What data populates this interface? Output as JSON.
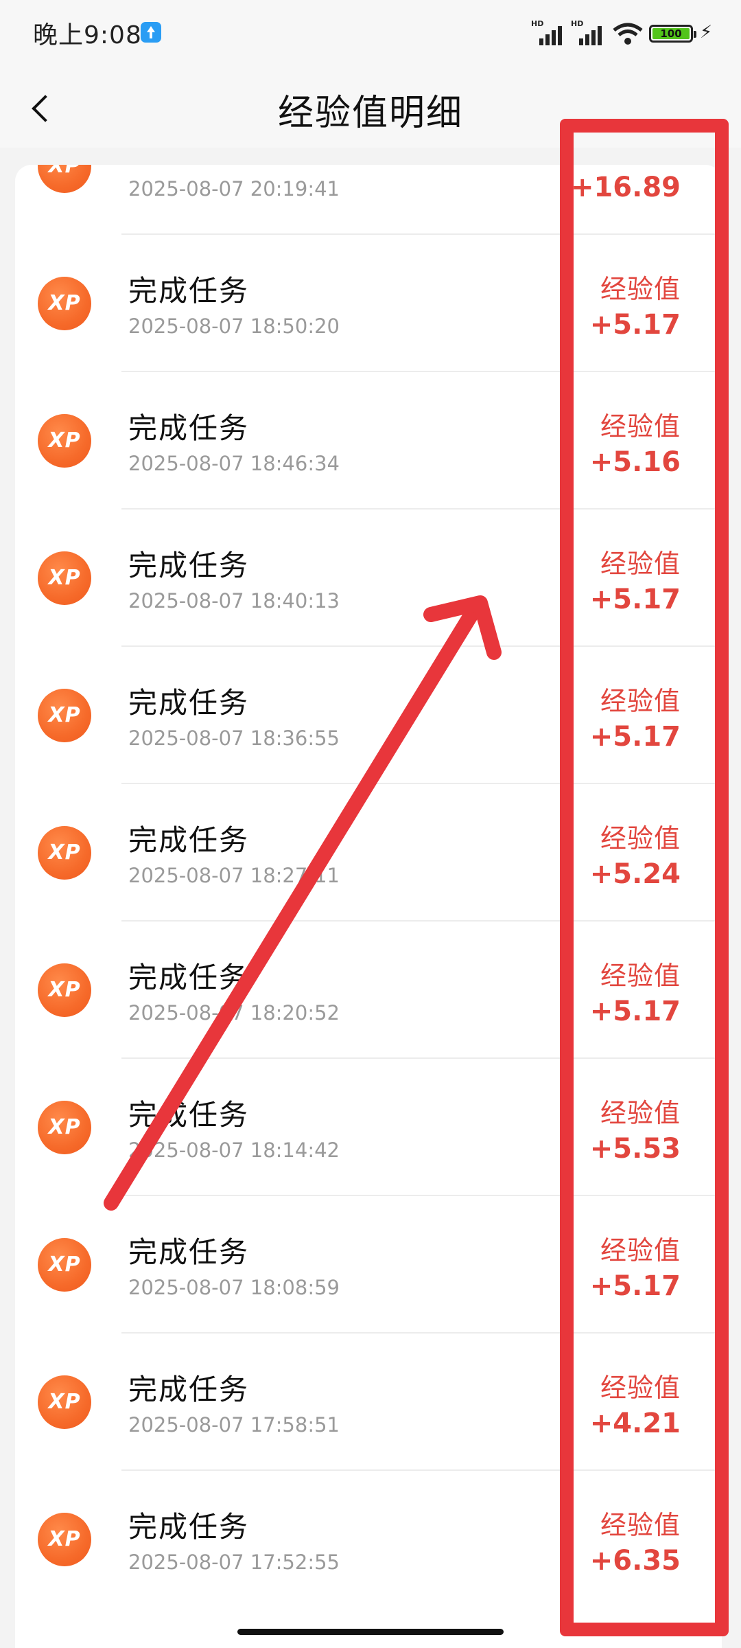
{
  "status_bar": {
    "time": "晚上9:08",
    "signal1": "HD",
    "signal2": "HD",
    "battery": "100",
    "icons": [
      "upload-notification-icon",
      "signal-icon",
      "signal-icon",
      "wifi-icon",
      "battery-icon",
      "charging-icon"
    ]
  },
  "header": {
    "title": "经验值明细",
    "back_icon": "chevron-left-icon"
  },
  "colors": {
    "accent": "#e2463e",
    "xp_badge": "#f66a2a",
    "annotation": "#e8363b"
  },
  "list": {
    "top_partial": {
      "time": "2025-08-07 20:19:41",
      "amount": "+16.89"
    },
    "items": [
      {
        "label": "完成任务",
        "time": "2025-08-07 18:50:20",
        "kind": "经验值",
        "amount": "+5.17"
      },
      {
        "label": "完成任务",
        "time": "2025-08-07 18:46:34",
        "kind": "经验值",
        "amount": "+5.16"
      },
      {
        "label": "完成任务",
        "time": "2025-08-07 18:40:13",
        "kind": "经验值",
        "amount": "+5.17"
      },
      {
        "label": "完成任务",
        "time": "2025-08-07 18:36:55",
        "kind": "经验值",
        "amount": "+5.17"
      },
      {
        "label": "完成任务",
        "time": "2025-08-07 18:27:11",
        "kind": "经验值",
        "amount": "+5.24"
      },
      {
        "label": "完成任务",
        "time": "2025-08-07 18:20:52",
        "kind": "经验值",
        "amount": "+5.17"
      },
      {
        "label": "完成任务",
        "time": "2025-08-07 18:14:42",
        "kind": "经验值",
        "amount": "+5.53"
      },
      {
        "label": "完成任务",
        "time": "2025-08-07 18:08:59",
        "kind": "经验值",
        "amount": "+5.17"
      },
      {
        "label": "完成任务",
        "time": "2025-08-07 17:58:51",
        "kind": "经验值",
        "amount": "+4.21"
      },
      {
        "label": "完成任务",
        "time": "2025-08-07 17:52:55",
        "kind": "经验值",
        "amount": "+6.35"
      }
    ],
    "badge_text": "XP"
  }
}
